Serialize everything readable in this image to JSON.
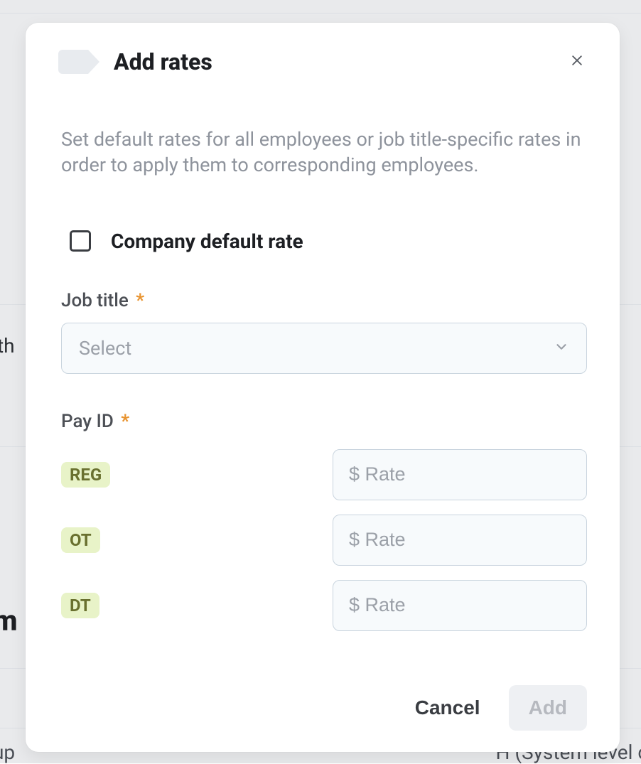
{
  "background": {
    "text_left": "oth",
    "text_bold_m": "m",
    "text_bottom_left": "up",
    "text_bottom_right": "H (System level c"
  },
  "modal": {
    "title": "Add rates",
    "description": "Set default rates for all employees or job title-specific rates in order to apply them to corresponding employees.",
    "checkbox_label": "Company default rate",
    "checkbox_checked": false,
    "job_title": {
      "label": "Job title",
      "required_mark": "*",
      "placeholder": "Select"
    },
    "pay_id": {
      "label": "Pay ID",
      "required_mark": "*",
      "rate_placeholder": "$ Rate",
      "rows": [
        {
          "code": "REG"
        },
        {
          "code": "OT"
        },
        {
          "code": "DT"
        }
      ]
    },
    "footer": {
      "cancel": "Cancel",
      "add": "Add"
    }
  }
}
